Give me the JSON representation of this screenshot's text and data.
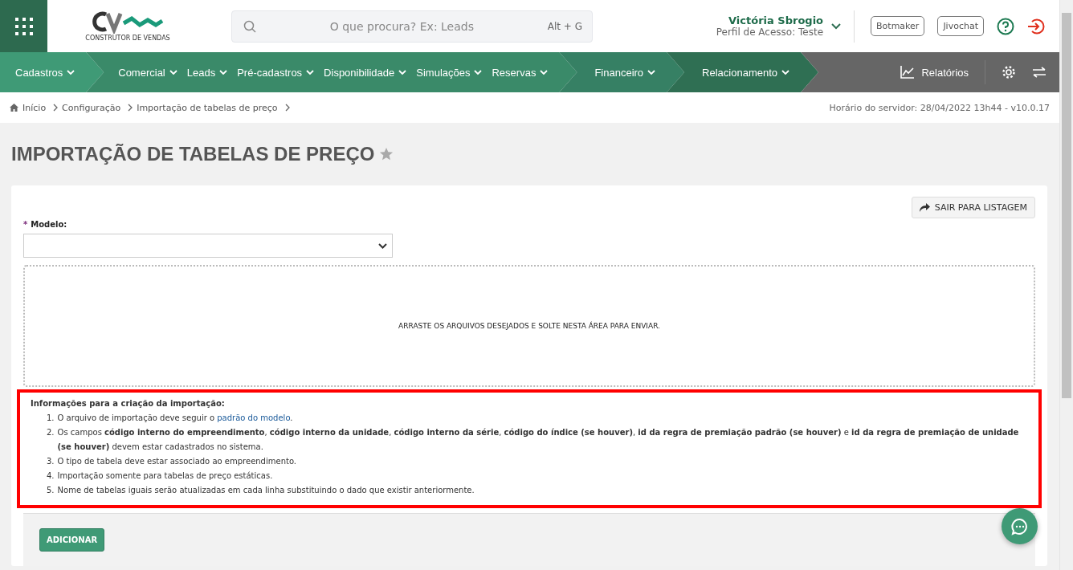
{
  "header": {
    "search": {
      "placeholder": "O que procura? Ex: Leads",
      "shortcut": "Alt + G"
    },
    "logo_caption": "CONSTRUTOR DE VENDAS",
    "user": {
      "name": "Victória Sbrogio",
      "profile": "Perfil de Acesso: Teste"
    },
    "buttons": [
      "Botmaker",
      "Jivochat"
    ]
  },
  "nav": {
    "segments": [
      {
        "color": "#3f9a76",
        "items": [
          "Cadastros"
        ]
      },
      {
        "color": "#3a8a69",
        "items": [
          "Comercial",
          "Leads",
          "Pré-cadastros",
          "Disponibilidade",
          "Simulações",
          "Reservas"
        ]
      },
      {
        "color": "#368064",
        "items": [
          "Financeiro"
        ]
      },
      {
        "color": "#2f6f53",
        "items": [
          "Relacionamento"
        ]
      }
    ],
    "reports": "Relatórios"
  },
  "breadcrumb": [
    "Início",
    "Configuração",
    "Importação de tabelas de preço"
  ],
  "server_time": "Horário do servidor: 28/04/2022 13h44 - v10.0.17",
  "page": {
    "title": "IMPORTAÇÃO DE TABELAS DE PREÇO",
    "favorite": false,
    "exit_button": "SAIR PARA LISTAGEM",
    "field": {
      "label": "Modelo:",
      "required_mark": "*"
    },
    "dropzone": "ARRASTE OS ARQUIVOS DESEJADOS E SOLTE NESTA ÁREA PARA ENVIAR.",
    "info": {
      "highlighted": true,
      "title": "Informações para a criação da importação:",
      "items": [
        {
          "number": "1.",
          "parts": [
            {
              "kind": "text",
              "text": "O arquivo de importação deve seguir o "
            },
            {
              "kind": "link",
              "text": "padrão do modelo"
            },
            {
              "kind": "text",
              "text": "."
            }
          ]
        },
        {
          "number": "2.",
          "parts": [
            {
              "kind": "text",
              "text": "Os campos **código interno do empreendimento**, **código interno da unidade**, **código interno da série**, **código do índice (se houver)**, **id da regra de premiação padrão (se houver)** e **id da regra de premiação de unidade (se houver)** devem estar cadastrados no sistema."
            }
          ]
        },
        {
          "number": "3.",
          "parts": [
            {
              "kind": "text",
              "text": "O tipo de tabela deve estar associado ao empreendimento."
            }
          ]
        },
        {
          "number": "4.",
          "parts": [
            {
              "kind": "text",
              "text": "Importação somente para tabelas de preço estáticas."
            }
          ]
        },
        {
          "number": "5.",
          "parts": [
            {
              "kind": "text",
              "text": "Nome de tabelas iguais serão atualizadas em cada linha substituindo o dado que existir anteriormente."
            }
          ]
        }
      ]
    },
    "add_button": "ADICIONAR"
  }
}
